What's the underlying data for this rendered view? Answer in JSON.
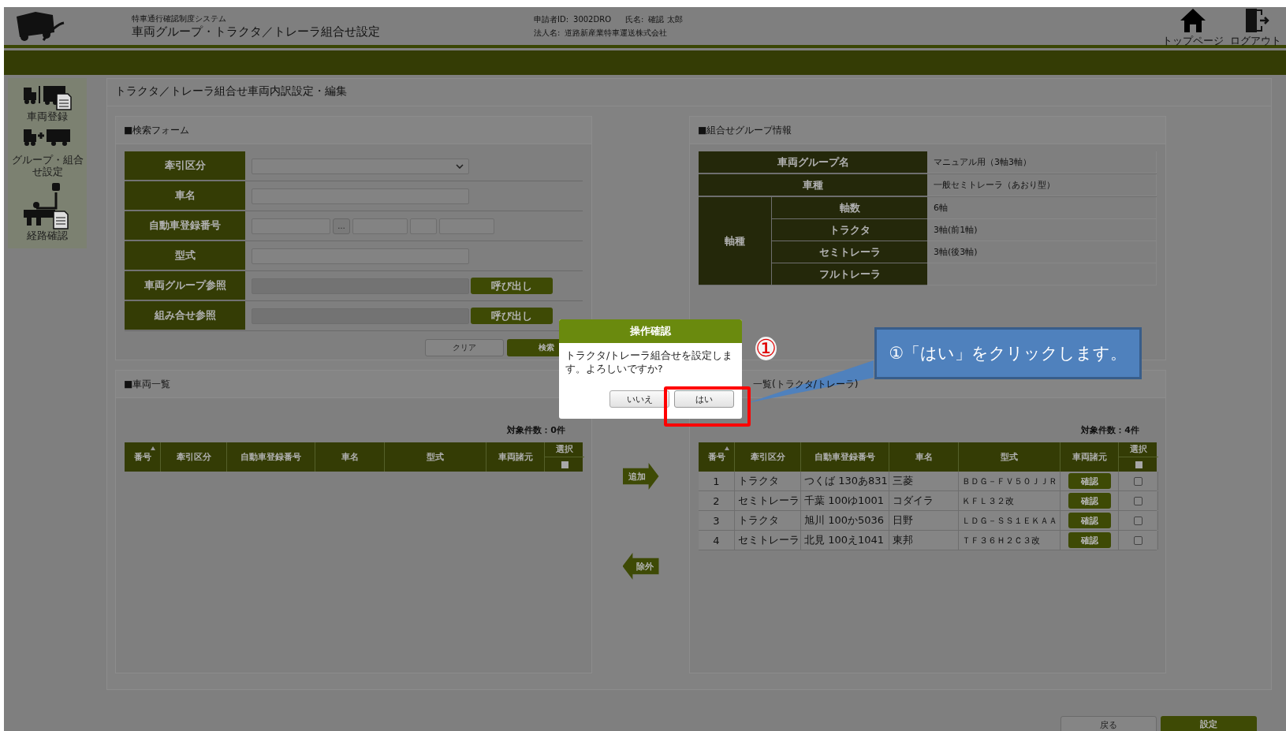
{
  "header": {
    "system_name": "特車通行確認制度システム",
    "page_title": "車両グループ・トラクタ／トレーラ組合せ設定",
    "applicant_id_label": "申請者ID:",
    "applicant_id": "3002DRO",
    "name_label": "氏名:",
    "name": "確認 太郎",
    "corp_label": "法人名:",
    "corp": "道路新産業特車運送株式会社",
    "nav": [
      {
        "kind": "home",
        "label": "トップページ"
      },
      {
        "kind": "logout",
        "label": "ログアウト"
      }
    ]
  },
  "sidebar": {
    "items": [
      {
        "kind": "register",
        "label": "車両登録"
      },
      {
        "kind": "combine",
        "label": "グループ・組合せ設定"
      },
      {
        "kind": "route",
        "label": "経路確認"
      }
    ]
  },
  "content_title": "トラクタ／トレーラ組合せ車両内訳設定・編集",
  "search_form": {
    "title": "■検索フォーム",
    "rows": [
      {
        "kind": "select",
        "label": "牽引区分"
      },
      {
        "kind": "text",
        "label": "車名"
      },
      {
        "kind": "plate",
        "label": "自動車登録番号",
        "button": "…"
      },
      {
        "kind": "text",
        "label": "型式"
      },
      {
        "kind": "ref",
        "label": "車両グループ参照",
        "button": "呼び出し"
      },
      {
        "kind": "ref",
        "label": "組み合せ参照",
        "button": "呼び出し"
      }
    ],
    "buttons": [
      {
        "kind": "secondary",
        "label": "クリア"
      },
      {
        "kind": "primary",
        "label": "検索"
      }
    ]
  },
  "group_info": {
    "title": "■組合せグループ情報",
    "rows": [
      {
        "label": "車両グループ名",
        "value": "マニュアル用（3軸3軸）"
      },
      {
        "label": "車種",
        "value": "一般セミトレーラ（あおり型）"
      }
    ],
    "axle": {
      "label": "軸種",
      "rows": [
        {
          "label": "軸数",
          "value": "6軸"
        },
        {
          "label": "トラクタ",
          "value": "3軸(前1軸)"
        },
        {
          "label": "セミトレーラ",
          "value": "3軸(後3軸)"
        },
        {
          "label": "フルトレーラ",
          "value": ""
        }
      ]
    }
  },
  "vehicle_list": {
    "title": "■車両一覧",
    "count": "対象件数：0件",
    "columns": [
      "番号",
      "牽引区分",
      "自動車登録番号",
      "車名",
      "型式",
      "車両諸元",
      "選択"
    ],
    "select_all_checked": false
  },
  "transfer": [
    {
      "kind": "add",
      "label": "追加"
    },
    {
      "kind": "remove",
      "label": "除外"
    }
  ],
  "combo_list": {
    "title": "一覧(トラクタ/トレーラ)",
    "count": "対象件数：4件",
    "columns": [
      "番号",
      "牽引区分",
      "自動車登録番号",
      "車名",
      "型式",
      "車両諸元",
      "選択"
    ],
    "select_all_checked": false,
    "rows": [
      {
        "no": "1",
        "type": "トラクタ",
        "plate": "つくば 130あ831",
        "name": "三菱",
        "model": "ＢＤＧ－ＦＶ５０ＪＪＲ",
        "button": "確認",
        "checked": false
      },
      {
        "no": "2",
        "type": "セミトレーラ",
        "plate": "千葉 100ゆ1001",
        "name": "コダイラ",
        "model": "ＫＦＬ３２改",
        "button": "確認",
        "checked": false
      },
      {
        "no": "3",
        "type": "トラクタ",
        "plate": "旭川 100か5036",
        "name": "日野",
        "model": "ＬＤＧ－ＳＳ１ＥＫＡＡ",
        "button": "確認",
        "checked": false
      },
      {
        "no": "4",
        "type": "セミトレーラ",
        "plate": "北見 100え1041",
        "name": "東邦",
        "model": "ＴＦ３６Ｈ２Ｃ３改",
        "button": "確認",
        "checked": false
      }
    ]
  },
  "footer_buttons": [
    {
      "kind": "secondary",
      "label": "戻る"
    },
    {
      "kind": "primary",
      "label": "設定"
    }
  ],
  "dialog": {
    "title": "操作確認",
    "message": "トラクタ/トレーラ組合せを設定します。よろしいですか?",
    "buttons": [
      {
        "label": "いいえ",
        "highlighted": false
      },
      {
        "label": "はい",
        "highlighted": true
      }
    ]
  },
  "annotation": {
    "marker": "①",
    "callout": "①「はい」をクリックします。"
  }
}
